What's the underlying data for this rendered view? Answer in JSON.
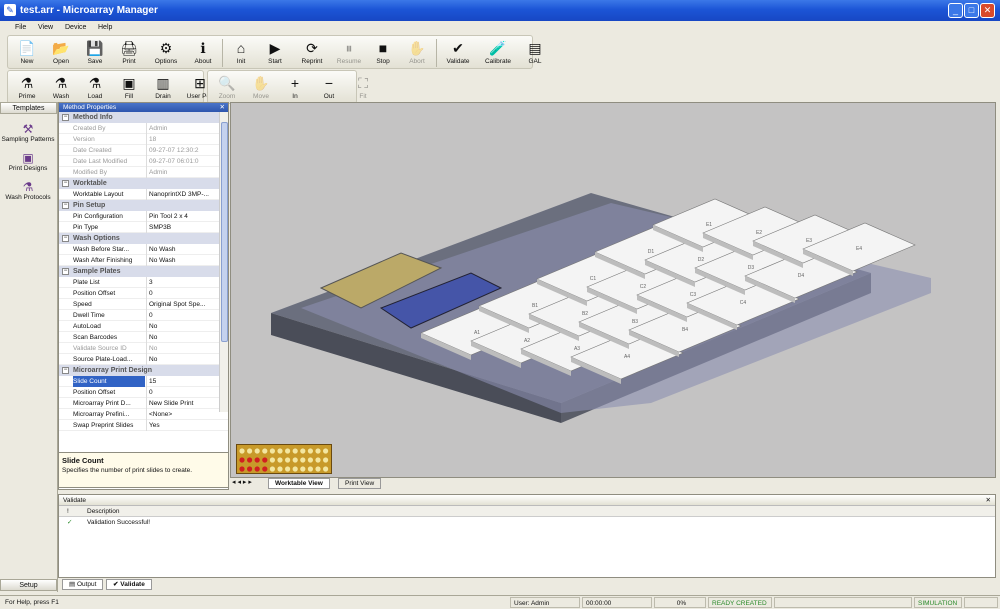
{
  "window": {
    "title": "test.arr - Microarray Manager"
  },
  "menu": [
    "File",
    "View",
    "Device",
    "Help"
  ],
  "toolbar1": [
    {
      "label": "New",
      "icon": "new-icon",
      "glyph": "📄"
    },
    {
      "label": "Open",
      "icon": "open-icon",
      "glyph": "📂"
    },
    {
      "label": "Save",
      "icon": "save-icon",
      "glyph": "💾"
    },
    {
      "label": "Print",
      "icon": "print-icon",
      "glyph": "🖨"
    },
    {
      "label": "Options",
      "icon": "options-icon",
      "glyph": "⚙"
    },
    {
      "label": "About",
      "icon": "about-icon",
      "glyph": "ℹ"
    },
    {
      "label": "Init",
      "icon": "init-icon",
      "glyph": "⌂"
    },
    {
      "label": "Start",
      "icon": "start-icon",
      "glyph": "▶"
    },
    {
      "label": "Reprint",
      "icon": "reprint-icon",
      "glyph": "⟳"
    },
    {
      "label": "Resume",
      "icon": "resume-icon",
      "glyph": "⏸",
      "disabled": true
    },
    {
      "label": "Stop",
      "icon": "stop-icon",
      "glyph": "■"
    },
    {
      "label": "Abort",
      "icon": "abort-icon",
      "glyph": "✋",
      "disabled": true
    },
    {
      "label": "Validate",
      "icon": "validate-icon",
      "glyph": "✔"
    },
    {
      "label": "Calibrate",
      "icon": "calibrate-icon",
      "glyph": "🧪"
    },
    {
      "label": "GAL",
      "icon": "gal-icon",
      "glyph": "▤"
    }
  ],
  "toolbar2": [
    {
      "label": "Prime",
      "icon": "prime-icon",
      "glyph": "⚗"
    },
    {
      "label": "Wash",
      "icon": "wash-icon",
      "glyph": "⚗"
    },
    {
      "label": "Load",
      "icon": "load-icon",
      "glyph": "⚗"
    },
    {
      "label": "Fill",
      "icon": "fill-icon",
      "glyph": "▣"
    },
    {
      "label": "Drain",
      "icon": "drain-icon",
      "glyph": "▥"
    },
    {
      "label": "User Pos",
      "icon": "user-pos-icon",
      "glyph": "⊞"
    }
  ],
  "toolbar3": [
    {
      "label": "Zoom",
      "icon": "zoom-icon",
      "glyph": "🔍",
      "disabled": true
    },
    {
      "label": "Move",
      "icon": "move-icon",
      "glyph": "✋",
      "disabled": true
    },
    {
      "label": "In",
      "icon": "zoom-in-icon",
      "glyph": "+"
    },
    {
      "label": "Out",
      "icon": "zoom-out-icon",
      "glyph": "−"
    },
    {
      "label": "Fit",
      "icon": "fit-icon",
      "glyph": "⛶",
      "disabled": true
    }
  ],
  "nav": {
    "header": "Templates",
    "footer": "Setup",
    "items": [
      "Sampling Patterns",
      "Print Designs",
      "Wash Protocols"
    ]
  },
  "props": {
    "title": "Method Properties",
    "groups": [
      {
        "name": "Method Info",
        "rows": [
          [
            "Created By",
            "Admin",
            1
          ],
          [
            "Version",
            "18",
            1
          ],
          [
            "Date Created",
            "09-27-07 12:30:2",
            1
          ],
          [
            "Date Last Modified",
            "09-27-07 06:01:0",
            1
          ],
          [
            "Modified By",
            "Admin",
            1
          ]
        ]
      },
      {
        "name": "Worktable",
        "rows": [
          [
            "Worktable Layout",
            "NanoprintXD 3MP-...",
            0
          ]
        ]
      },
      {
        "name": "Pin Setup",
        "rows": [
          [
            "Pin Configuration",
            "Pin Tool 2 x 4",
            0
          ],
          [
            "Pin Type",
            "SMP3B",
            0
          ]
        ]
      },
      {
        "name": "Wash Options",
        "rows": [
          [
            "Wash Before Star...",
            "No Wash",
            0
          ],
          [
            "Wash After Finishing",
            "No Wash",
            0
          ]
        ]
      },
      {
        "name": "Sample Plates",
        "rows": [
          [
            "Plate List",
            "3",
            0
          ],
          [
            "Position Offset",
            "0",
            0
          ],
          [
            "Speed",
            "Original Spot Spe...",
            0
          ],
          [
            "Dwell Time",
            "0",
            0
          ],
          [
            "AutoLoad",
            "No",
            0
          ],
          [
            "Scan Barcodes",
            "No",
            0
          ],
          [
            "Validate Source ID",
            "No",
            1
          ],
          [
            "Source Plate-Load...",
            "No",
            0
          ]
        ]
      },
      {
        "name": "Microarray Print Design",
        "rows": [
          [
            "Slide Count",
            "15",
            2
          ],
          [
            "Position Offset",
            "0",
            0
          ],
          [
            "Microarray Print D...",
            "New Slide Print",
            0
          ],
          [
            "Microarray Prefini...",
            "<None>",
            0
          ],
          [
            "Swap Preprint Slides",
            "Yes",
            0
          ]
        ]
      }
    ]
  },
  "desc": {
    "title": "Slide Count",
    "text": "Specifies the number of print slides to create."
  },
  "tabs": [
    "Worktable View",
    "Print View"
  ],
  "validate": {
    "title": "Validate",
    "col_index": "!",
    "col_desc": "Description",
    "row_mark": "✓",
    "row_text": "Validation Successful!"
  },
  "output_tabs": [
    "Output",
    "Validate"
  ],
  "plates": [
    "A1",
    "A2",
    "A3",
    "A4",
    "B1",
    "B2",
    "B3",
    "B4",
    "C1",
    "C2",
    "C3",
    "C4",
    "D1",
    "D2",
    "D3",
    "D4",
    "E1",
    "E2",
    "E3",
    "E4"
  ],
  "status": {
    "help": "For Help, press F1",
    "user": "User: Admin",
    "time": "00:00:00",
    "percent": "0%",
    "state": "READY CREATED",
    "sim": "SIMULATION"
  }
}
